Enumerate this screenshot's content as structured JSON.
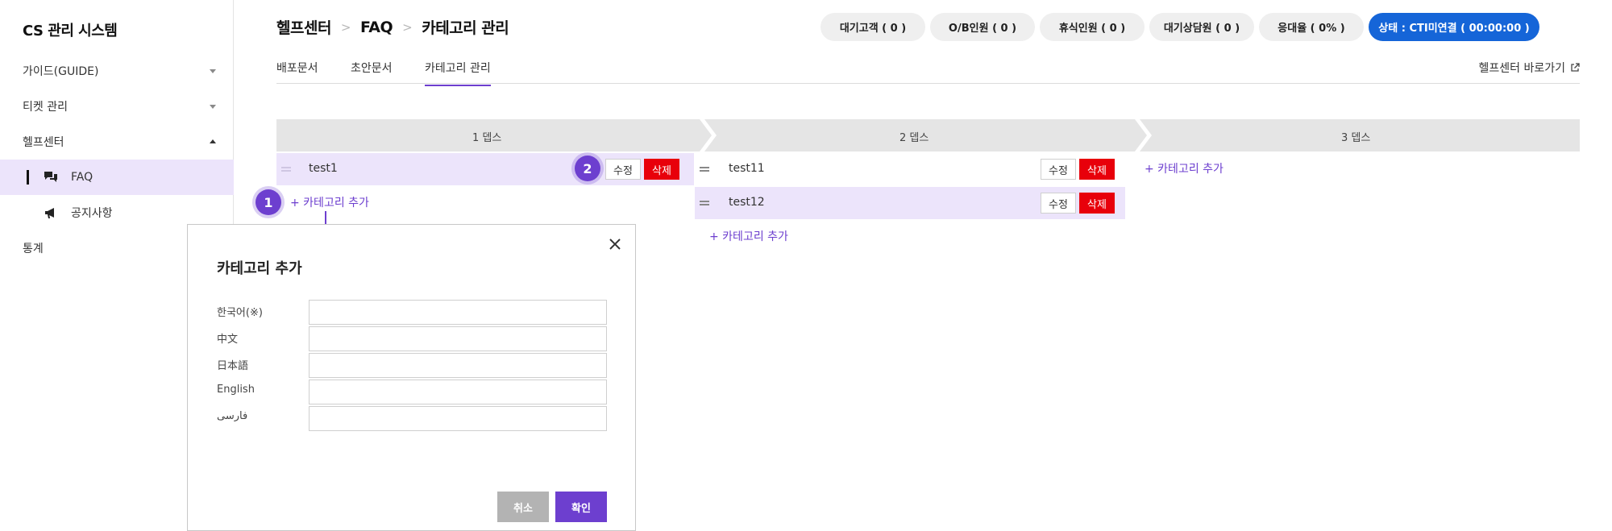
{
  "app": {
    "title": "CS 관리 시스템"
  },
  "sidebar": {
    "items": [
      {
        "label": "가이드(GUIDE)",
        "caret": "chevron-down-icon"
      },
      {
        "label": "티켓 관리",
        "caret": "chevron-down-icon"
      },
      {
        "label": "헬프센터",
        "caret": "chevron-up-icon"
      }
    ],
    "sub_items": [
      {
        "label": "FAQ",
        "icon": "chat-icon",
        "active": true
      },
      {
        "label": "공지사항",
        "icon": "megaphone-icon",
        "active": false
      }
    ],
    "stats_item": {
      "label": "통계"
    }
  },
  "header": {
    "breadcrumb": [
      "헬프센터",
      "FAQ",
      "카테고리 관리"
    ],
    "stats": [
      {
        "label": "대기고객 ( 0 )"
      },
      {
        "label": "O/B인원 ( 0 )"
      },
      {
        "label": "휴식인원 ( 0 )"
      },
      {
        "label": "대기상담원 ( 0 )"
      },
      {
        "label": "응대율 ( 0% )"
      }
    ],
    "status": {
      "label": "상태 : CTI미연결 ( 00:00:00 )",
      "color": "#1565d8"
    }
  },
  "tabs": [
    {
      "label": "배포문서",
      "active": false
    },
    {
      "label": "초안문서",
      "active": false
    },
    {
      "label": "카테고리 관리",
      "active": true
    }
  ],
  "help_link": {
    "label": "헬프센터 바로가기",
    "icon": "external-link-icon"
  },
  "depth": {
    "labels": [
      "1 뎁스",
      "2 뎁스",
      "3 뎁스"
    ],
    "col1": [
      {
        "label": "test1",
        "selected": true
      }
    ],
    "col2": [
      {
        "label": "test11",
        "selected": false
      },
      {
        "label": "test12",
        "selected": true
      }
    ],
    "edit_label": "수정",
    "delete_label": "삭제",
    "add_label": "+ 카테고리 추가"
  },
  "callouts": [
    "1",
    "2"
  ],
  "modal": {
    "title": "카테고리 추가",
    "fields": [
      {
        "label": "한국어(※)",
        "value": ""
      },
      {
        "label": "中文",
        "value": ""
      },
      {
        "label": "日本語",
        "value": ""
      },
      {
        "label": "English",
        "value": ""
      },
      {
        "label": "فارسی",
        "value": ""
      }
    ],
    "cancel_label": "취소",
    "confirm_label": "확인"
  },
  "colors": {
    "accent": "#6d3fcf",
    "selected_row": "#ece4fb",
    "delete": "#e8000b",
    "status": "#1565d8"
  }
}
